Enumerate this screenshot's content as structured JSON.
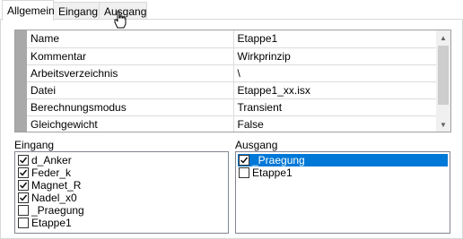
{
  "tabs": [
    {
      "label": "Allgemein",
      "active": true
    },
    {
      "label": "Eingang",
      "active": false
    },
    {
      "label": "Ausgang",
      "active": false
    }
  ],
  "properties": [
    {
      "key": "Name",
      "value": "Etappe1"
    },
    {
      "key": "Kommentar",
      "value": "Wirkprinzip"
    },
    {
      "key": "Arbeitsverzeichnis",
      "value": "\\"
    },
    {
      "key": "Datei",
      "value": "Etappe1_xx.isx"
    },
    {
      "key": "Berechnungsmodus",
      "value": "Transient"
    },
    {
      "key": "Gleichgewicht",
      "value": "False"
    }
  ],
  "eingang": {
    "label": "Eingang",
    "items": [
      {
        "label": "d_Anker",
        "checked": true
      },
      {
        "label": "Feder_k",
        "checked": true
      },
      {
        "label": "Magnet_R",
        "checked": true
      },
      {
        "label": "Nadel_x0",
        "checked": true
      },
      {
        "label": "_Praegung",
        "checked": false
      },
      {
        "label": "Etappe1",
        "checked": false
      }
    ]
  },
  "ausgang": {
    "label": "Ausgang",
    "items": [
      {
        "label": "_Praegung",
        "checked": true,
        "selected": true
      },
      {
        "label": "Etappe1",
        "checked": false,
        "selected": false
      }
    ]
  },
  "colors": {
    "selection": "#0078d7",
    "gutter": "#a9a9a9"
  }
}
